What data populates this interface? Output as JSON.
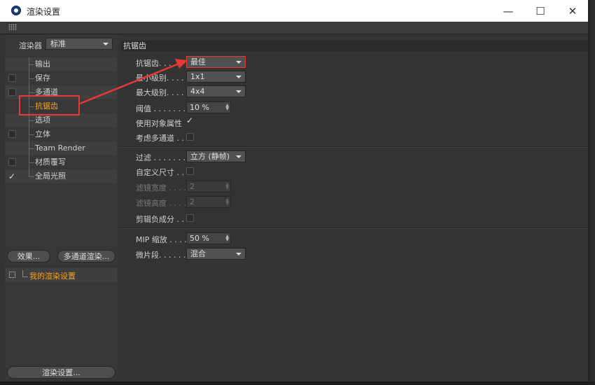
{
  "window": {
    "title": "渲染设置",
    "minimize": "—",
    "maximize": "☐",
    "close": "✕"
  },
  "left": {
    "renderer_label": "渲染器",
    "renderer_value": "标准",
    "tree": [
      {
        "label": "输出",
        "checkbox": false,
        "checked": false
      },
      {
        "label": "保存",
        "checkbox": true,
        "checked": false
      },
      {
        "label": "多通道",
        "checkbox": true,
        "checked": false
      },
      {
        "label": "抗锯齿",
        "checkbox": false,
        "checked": false,
        "active": true
      },
      {
        "label": "选项",
        "checkbox": false,
        "checked": false
      },
      {
        "label": "立体",
        "checkbox": true,
        "checked": false
      },
      {
        "label": "Team Render",
        "checkbox": false,
        "checked": false
      },
      {
        "label": "材质覆写",
        "checkbox": true,
        "checked": false
      },
      {
        "label": "全局光照",
        "checkbox": true,
        "checked": true
      }
    ],
    "effects_button": "效果...",
    "multipass_button": "多通道渲染...",
    "preset_label": "我的渲染设置",
    "render_settings_button": "渲染设置..."
  },
  "right": {
    "section_title": "抗锯齿",
    "antialiasing_label": "抗锯齿. . . .",
    "antialiasing_value": "最佳",
    "min_level_label": "最小级别. . . .",
    "min_level_value": "1x1",
    "max_level_label": "最大级别. . . .",
    "max_level_value": "4x4",
    "threshold_label": "阈值 . . . . . . .",
    "threshold_value": "10 %",
    "use_object_props_label": "使用对象属性",
    "use_object_props_checked": true,
    "consider_multipass_label": "考虑多通道 . .",
    "filter_label": "过滤 . . . . . . .",
    "filter_value": "立方 (静帧)",
    "custom_size_label": "自定义尺寸 . .",
    "filter_width_label": "滤镜宽度 . . . .",
    "filter_width_value": "2",
    "filter_height_label": "滤镜高度 . . . .",
    "filter_height_value": "2",
    "clip_negative_label": "剪辑负成分 . .",
    "mip_label": "MIP 缩放 . . . .",
    "mip_value": "50 %",
    "micropoly_label": "微片段. . . . . .",
    "micropoly_value": "混合"
  },
  "colors": {
    "accent": "#f7a21a",
    "annotation": "#e53935"
  }
}
